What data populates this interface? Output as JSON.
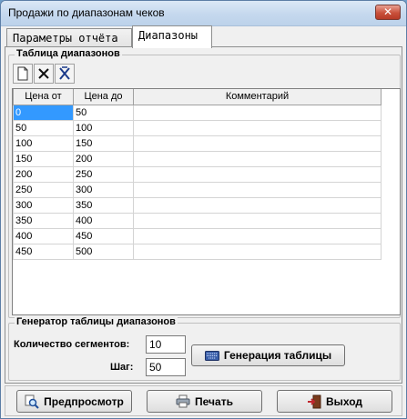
{
  "window": {
    "title": "Продажи по диапазонам чеков"
  },
  "tabs": [
    {
      "label": "Параметры отчёта"
    },
    {
      "label": "Диапазоны"
    }
  ],
  "ranges_group": {
    "title": "Таблица диапазонов"
  },
  "ranges_table": {
    "columns": [
      "Цена от",
      "Цена до",
      "Комментарий"
    ],
    "rows": [
      {
        "from": "0",
        "to": "50",
        "comment": ""
      },
      {
        "from": "50",
        "to": "100",
        "comment": ""
      },
      {
        "from": "100",
        "to": "150",
        "comment": ""
      },
      {
        "from": "150",
        "to": "200",
        "comment": ""
      },
      {
        "from": "200",
        "to": "250",
        "comment": ""
      },
      {
        "from": "250",
        "to": "300",
        "comment": ""
      },
      {
        "from": "300",
        "to": "350",
        "comment": ""
      },
      {
        "from": "350",
        "to": "400",
        "comment": ""
      },
      {
        "from": "400",
        "to": "450",
        "comment": ""
      },
      {
        "from": "450",
        "to": "500",
        "comment": ""
      }
    ]
  },
  "generator": {
    "title": "Генератор таблицы диапазонов",
    "segments_label": "Количество сегментов:",
    "segments_value": "10",
    "step_label": "Шаг:",
    "step_value": "50",
    "generate_label": "Генерация таблицы"
  },
  "footer": {
    "preview_label": "Предпросмотр",
    "print_label": "Печать",
    "exit_label": "Выход"
  },
  "icons": {
    "toolbar": [
      "new-row-icon",
      "delete-row-icon",
      "delete-all-rows-icon"
    ],
    "generate": "keyboard-icon",
    "preview": "magnifier-icon",
    "print": "printer-icon",
    "exit": "exit-door-icon"
  }
}
